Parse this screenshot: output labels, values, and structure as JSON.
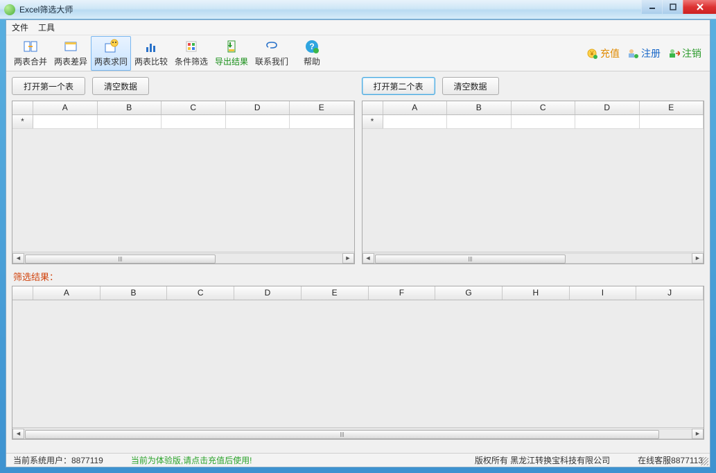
{
  "titlebar": {
    "title": "Excel筛选大师"
  },
  "menu": {
    "file": "文件",
    "tools": "工具"
  },
  "toolbar": {
    "merge": "两表合并",
    "diff": "两表差异",
    "same": "两表求同",
    "compare": "两表比较",
    "filter": "条件筛选",
    "export": "导出结果",
    "contact": "联系我们",
    "help": "帮助"
  },
  "right_links": {
    "recharge": "充值",
    "register": "注册",
    "logout": "注销"
  },
  "left_panel": {
    "open_btn": "打开第一个表",
    "clear_btn": "清空数据",
    "columns": [
      "A",
      "B",
      "C",
      "D",
      "E"
    ],
    "row_marker": "*"
  },
  "right_panel": {
    "open_btn": "打开第二个表",
    "clear_btn": "清空数据",
    "columns": [
      "A",
      "B",
      "C",
      "D",
      "E"
    ],
    "row_marker": "*"
  },
  "result": {
    "label": "筛选结果：",
    "columns": [
      "A",
      "B",
      "C",
      "D",
      "E",
      "F",
      "G",
      "H",
      "I",
      "J"
    ]
  },
  "status": {
    "user": "当前系统用户：8877119",
    "trial": "当前为体验版,请点击充值后使用!",
    "copyright": "版权所有   黑龙江转换宝科技有限公司",
    "service": "在线客服8877113"
  }
}
